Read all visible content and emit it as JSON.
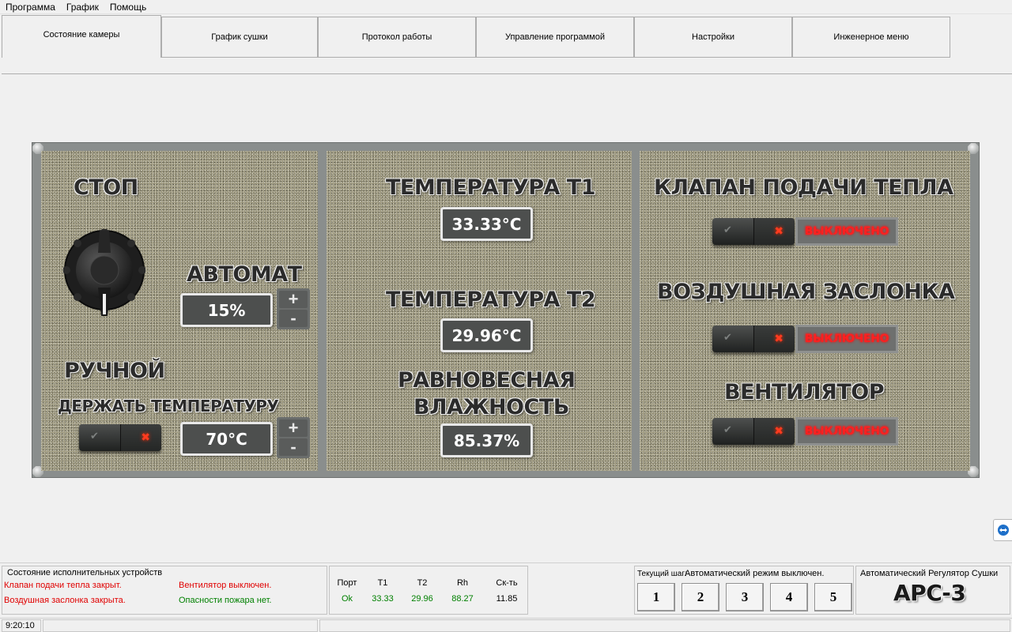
{
  "menu": [
    "Программа",
    "График",
    "Помощь"
  ],
  "tabs": [
    "Состояние камеры",
    "График сушки",
    "Протокол работы",
    "Управление программой",
    "Настройки",
    "Инженерное меню"
  ],
  "left": {
    "stop_label": "СТОП",
    "auto_label": "АВТОМАТ",
    "manual_label": "РУЧНОЙ",
    "power_value": "15%",
    "hold_temp_label": "ДЕРЖАТЬ ТЕМПЕРАТУРУ",
    "hold_temp_value": "70°C",
    "plus": "+",
    "minus": "-"
  },
  "middle": {
    "t1_label": "ТЕМПЕРАТУРА Т1",
    "t1_value": "33.33°C",
    "t2_label": "ТЕМПЕРАТУРА Т2",
    "t2_value": "29.96°C",
    "rh_label_1": "РАВНОВЕСНАЯ",
    "rh_label_2": "ВЛАЖНОСТЬ",
    "rh_value": "85.37%"
  },
  "right": {
    "valve_label": "КЛАПАН ПОДАЧИ ТЕПЛА",
    "valve_status": "ВЫКЛЮЧЕНО",
    "damper_label": "ВОЗДУШНАЯ ЗАСЛОНКА",
    "damper_status": "ВЫКЛЮЧЕНО",
    "fan_label": "ВЕНТИЛЯТОР",
    "fan_status": "ВЫКЛЮЧЕНО"
  },
  "devices": {
    "title": "Состояние исполнительных устройств",
    "valve": "Клапан подачи тепла закрыт.",
    "damper": "Воздушная заслонка закрыта.",
    "fan": "Вентилятор выключен.",
    "fire": "Опасности пожара нет."
  },
  "readings": {
    "headers": [
      "Порт",
      "T1",
      "T2",
      "Rh",
      "Ск-ть"
    ],
    "values": [
      "Ok",
      "33.33",
      "29.96",
      "88.27",
      "11.85"
    ]
  },
  "steps": {
    "current_label": "Текущий шаг:",
    "mode_text": "Автоматический режим выключен.",
    "buttons": [
      "1",
      "2",
      "3",
      "4",
      "5"
    ]
  },
  "brand": {
    "title": "Автоматический Регулятор Сушки",
    "logo": "АРС-3"
  },
  "statusbar": {
    "time": "9:20:10"
  },
  "colors": {
    "status_red": "#e00000",
    "status_green": "#008000",
    "indicator_red": "#ff2020"
  }
}
